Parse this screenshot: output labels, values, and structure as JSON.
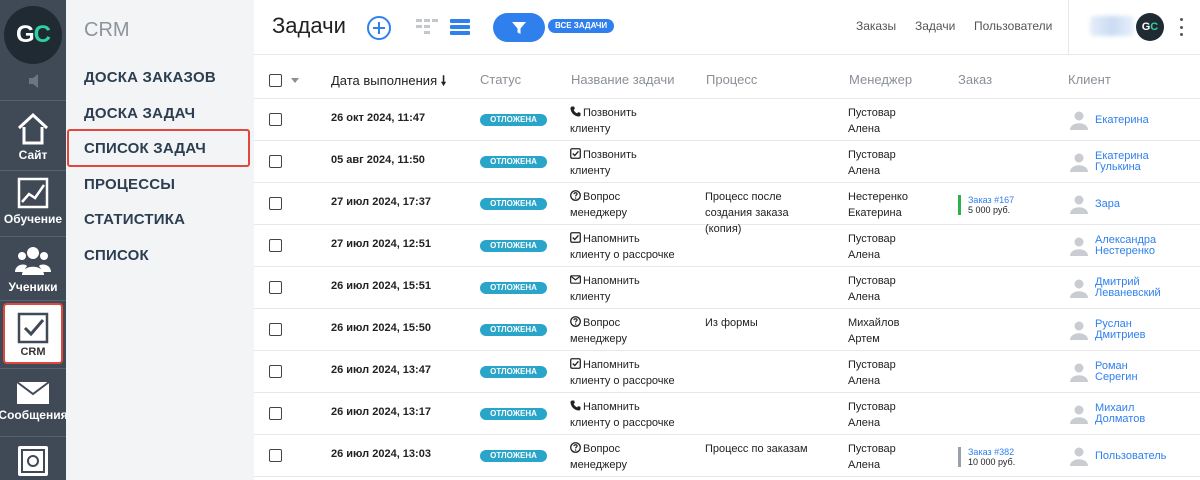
{
  "rail": {
    "logo_left": "G",
    "logo_right": "C",
    "items": [
      {
        "label": "Сайт"
      },
      {
        "label": "Обучение"
      },
      {
        "label": "Ученики"
      },
      {
        "label": "CRM"
      },
      {
        "label": "Сообщения"
      }
    ]
  },
  "side": {
    "title": "CRM",
    "items": [
      {
        "label": "ДОСКА ЗАКАЗОВ"
      },
      {
        "label": "ДОСКА ЗАДАЧ"
      },
      {
        "label": "СПИСОК ЗАДАЧ",
        "active": true
      },
      {
        "label": "ПРОЦЕССЫ"
      },
      {
        "label": "СТАТИСТИКА"
      },
      {
        "label": "СПИСОК"
      }
    ]
  },
  "topbar": {
    "title": "Задачи",
    "filter_badge": "ВСЕ ЗАДАЧИ",
    "links": [
      "Заказы",
      "Задачи",
      "Пользователи"
    ],
    "avatar_left": "G",
    "avatar_right": "C"
  },
  "table": {
    "columns": [
      "Дата выполнения",
      "Статус",
      "Название задачи",
      "Процесс",
      "Менеджер",
      "Заказ",
      "Клиент"
    ],
    "sort_arrow": "🠗",
    "rows": [
      {
        "date": "26 окт 2024, 11:47",
        "status": "ОТЛОЖЕНА",
        "icon": "phone-icon",
        "task1": "Позвонить",
        "task2": "клиенту",
        "proc1": "",
        "proc2": "",
        "proc3": "",
        "mgr1": "Пустовар",
        "mgr2": "Алена",
        "order_link": "",
        "order_sum": "",
        "client1": "Екатерина",
        "client2": ""
      },
      {
        "date": "05 авг 2024, 11:50",
        "status": "ОТЛОЖЕНА",
        "icon": "checkbox-icon",
        "task1": "Позвонить",
        "task2": "клиенту",
        "proc1": "",
        "proc2": "",
        "proc3": "",
        "mgr1": "Пустовар",
        "mgr2": "Алена",
        "order_link": "",
        "order_sum": "",
        "client1": "Екатерина",
        "client2": "Гулькина"
      },
      {
        "date": "27 июл 2024, 17:37",
        "status": "ОТЛОЖЕНА",
        "icon": "question-icon",
        "task1": "Вопрос",
        "task2": "менеджеру",
        "proc1": "Процесс после",
        "proc2": "создания заказа",
        "proc3": "(копия)",
        "mgr1": "Нестеренко",
        "mgr2": "Екатерина",
        "order_link": "Заказ #167",
        "order_sum": "5 000 руб.",
        "order_color": "#2bb34a",
        "client1": "Зара",
        "client2": ""
      },
      {
        "date": "27 июл 2024, 12:51",
        "status": "ОТЛОЖЕНА",
        "icon": "checkbox-icon",
        "task1": "Напомнить",
        "task2": "клиенту о рассрочке",
        "proc1": "",
        "proc2": "",
        "proc3": "",
        "mgr1": "Пустовар",
        "mgr2": "Алена",
        "order_link": "",
        "order_sum": "",
        "client1": "Александра",
        "client2": "Нестеренко"
      },
      {
        "date": "26 июл 2024, 15:51",
        "status": "ОТЛОЖЕНА",
        "icon": "mail-icon",
        "task1": "Напомнить",
        "task2": "клиенту",
        "proc1": "",
        "proc2": "",
        "proc3": "",
        "mgr1": "Пустовар",
        "mgr2": "Алена",
        "order_link": "",
        "order_sum": "",
        "client1": "Дмитрий",
        "client2": "Леваневский"
      },
      {
        "date": "26 июл 2024, 15:50",
        "status": "ОТЛОЖЕНА",
        "icon": "question-icon",
        "task1": "Вопрос",
        "task2": "менеджеру",
        "proc1": "Из формы",
        "proc2": "",
        "proc3": "",
        "mgr1": "Михайлов",
        "mgr2": "Артем",
        "order_link": "",
        "order_sum": "",
        "client1": "Руслан",
        "client2": "Дмитриев"
      },
      {
        "date": "26 июл 2024, 13:47",
        "status": "ОТЛОЖЕНА",
        "icon": "checkbox-icon",
        "task1": "Напомнить",
        "task2": "клиенту о рассрочке",
        "proc1": "",
        "proc2": "",
        "proc3": "",
        "mgr1": "Пустовар",
        "mgr2": "Алена",
        "order_link": "",
        "order_sum": "",
        "client1": "Роман",
        "client2": "Серегин"
      },
      {
        "date": "26 июл 2024, 13:17",
        "status": "ОТЛОЖЕНА",
        "icon": "phone-icon",
        "task1": "Напомнить",
        "task2": "клиенту о рассрочке",
        "proc1": "",
        "proc2": "",
        "proc3": "",
        "mgr1": "Пустовар",
        "mgr2": "Алена",
        "order_link": "",
        "order_sum": "",
        "client1": "Михаил",
        "client2": "Долматов"
      },
      {
        "date": "26 июл 2024, 13:03",
        "status": "ОТЛОЖЕНА",
        "icon": "question-icon",
        "task1": "Вопрос",
        "task2": "менеджеру",
        "proc1": "Процесс по заказам",
        "proc2": "",
        "proc3": "",
        "mgr1": "Пустовар",
        "mgr2": "Алена",
        "order_link": "Заказ #382",
        "order_sum": "10 000 руб.",
        "order_color": "#9aa0a6",
        "client1": "Пользователь",
        "client2": ""
      }
    ]
  },
  "colors": {
    "rail": "#3f4a56",
    "accent": "#2f80ed",
    "status": "#29a5c9",
    "highlight": "#e0483d",
    "brand_green": "#2ed1a2"
  }
}
